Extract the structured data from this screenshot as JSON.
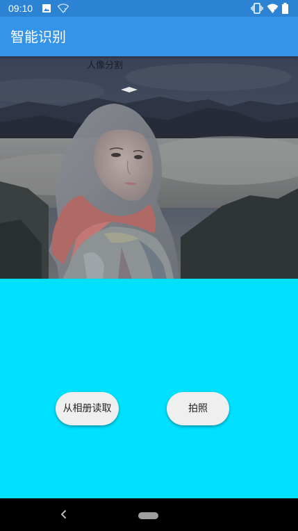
{
  "status_bar": {
    "time": "09:10",
    "left_icons": [
      "image-icon",
      "wifi-icon"
    ],
    "right_icons": [
      "vibrate-icon",
      "wifi-signal-icon",
      "battery-icon"
    ]
  },
  "app_bar": {
    "title": "智能识别",
    "color": "#3494EA"
  },
  "image_panel": {
    "label": "人像分割"
  },
  "buttons": {
    "album": "从相册读取",
    "photo": "拍照"
  },
  "background_color": "#00E1FF"
}
